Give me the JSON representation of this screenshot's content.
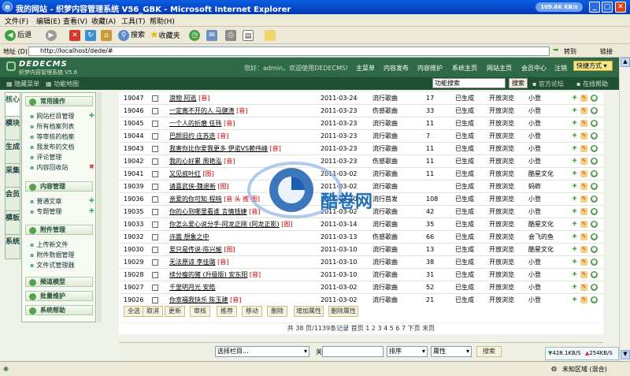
{
  "window": {
    "title": "我的网站 - 织梦内容管理系统 V56_GBK - Microsoft Internet Explorer",
    "speed": "109.6K KB/s"
  },
  "menubar": [
    "文件(F)",
    "编辑(E)",
    "查看(V)",
    "收藏(A)",
    "工具(T)",
    "帮助(H)"
  ],
  "toolbar": {
    "back": "后退",
    "search": "搜索",
    "favorites": "收藏夹"
  },
  "address": {
    "label": "地址 (D)",
    "url": "http://localhost/dede/#",
    "go": "转到",
    "links": "链接"
  },
  "header": {
    "logo": "DEDECMS",
    "logo_sub": "织梦内容管理系统",
    "version": "V5.6",
    "welcome": "您好：admin，欢迎使用DEDECMS!",
    "nav": [
      "主菜单",
      "内容发布",
      "内容维护",
      "系统主页",
      "网站主页",
      "会员中心",
      "注销"
    ],
    "quick": "快捷方式"
  },
  "subbar": {
    "hide_menu": "隐藏菜单",
    "func_map": "功能地图",
    "search_placeholder": "功能搜索",
    "search_btn": "搜索",
    "forum": "官方论坛",
    "help": "在线帮助"
  },
  "left_tabs": [
    "核心",
    "模块",
    "生成",
    "采集",
    "会员",
    "模板",
    "系统"
  ],
  "left_menu": {
    "sec1": "常用操作",
    "sec1_items": [
      "网站栏目管理",
      "所有档案列表",
      "等审核的档案",
      "我发布的文档",
      "评论管理",
      "内容回收站"
    ],
    "sec2": "内容管理",
    "sec2_items": [
      "普通文章",
      "专题管理"
    ],
    "sec3": "附件管理",
    "sec3_items": [
      "上传新文件",
      "附件数据管理",
      "文件式管理器"
    ],
    "sec4": "频道模型",
    "sec5": "批量维护",
    "sec6": "系统帮助"
  },
  "rows": [
    {
      "id": "19047",
      "title": "浪物 阿逃",
      "tag": "[音]",
      "date": "2011-03-24",
      "cat": "流行歌曲",
      "clicks": "17",
      "status": "已生成",
      "view": "开放浏览",
      "author": "小登"
    },
    {
      "id": "19046",
      "title": "一定离不开的人 马健涛",
      "tag": "[音]",
      "date": "2011-03-23",
      "cat": "伤感歌曲",
      "clicks": "33",
      "status": "已生成",
      "view": "开放浏览",
      "author": "小登"
    },
    {
      "id": "19045",
      "title": "一个人的折磨 任玮",
      "tag": "[音]",
      "date": "2011-03-23",
      "cat": "流行歌曲",
      "clicks": "11",
      "status": "已生成",
      "view": "开放浏览",
      "author": "小登"
    },
    {
      "id": "19044",
      "title": "巴颜旧约 庄苏迭",
      "tag": "[音]",
      "date": "2011-03-23",
      "cat": "流行歌曲",
      "clicks": "7",
      "status": "已生成",
      "view": "开放浏览",
      "author": "小登"
    },
    {
      "id": "19043",
      "title": "我害你比你爱我更多 伊诺VS赖伟峰",
      "tag": "[音]",
      "date": "2011-03-23",
      "cat": "流行歌曲",
      "clicks": "11",
      "status": "已生成",
      "view": "开放浏览",
      "author": "小登"
    },
    {
      "id": "19042",
      "title": "我的心好累 周艳泓",
      "tag": "[音]",
      "date": "2011-03-23",
      "cat": "伤感歌曲",
      "clicks": "11",
      "status": "已生成",
      "view": "开放浏览",
      "author": "小登"
    },
    {
      "id": "19041",
      "title": "又见叔叶红",
      "tag": "[图]",
      "date": "2011-03-02",
      "cat": "流行歌曲",
      "clicks": "11",
      "status": "已生成",
      "view": "开放浏览",
      "author": "酷星文化"
    },
    {
      "id": "19039",
      "title": "请喜武侠-魏退新",
      "tag": "[图]",
      "date": "2011-03-02",
      "cat": "流行歌曲",
      "clicks": "",
      "status": "已生成",
      "view": "开放浏览",
      "author": "蚂蚱"
    },
    {
      "id": "19036",
      "title": "亲爱的你可知 程响",
      "tag": "[音 头 推 图]",
      "date": "2011-03-10",
      "cat": "流行首发",
      "clicks": "108",
      "status": "已生成",
      "view": "开放浏览",
      "author": "小登"
    },
    {
      "id": "19035",
      "title": "你的心到哪里看谁 言情钱婕",
      "tag": "[音]",
      "date": "2011-03-02",
      "cat": "流行歌曲",
      "clicks": "42",
      "status": "已生成",
      "view": "开放浏览",
      "author": "小登"
    },
    {
      "id": "19033",
      "title": "你怎么爱心说分手-阿龙正刚 (阿龙正影)",
      "tag": "[图]",
      "date": "2011-03-14",
      "cat": "流行歌曲",
      "clicks": "35",
      "status": "已生成",
      "view": "开放浏览",
      "author": "酷星文化"
    },
    {
      "id": "19032",
      "title": "许嵩 想象之中",
      "tag": "",
      "date": "2011-03-13",
      "cat": "伤感歌曲",
      "clicks": "66",
      "status": "已生成",
      "view": "开放浏览",
      "author": "会飞的鱼"
    },
    {
      "id": "19030",
      "title": "爱只是传说-陈兴瑜",
      "tag": "[图]",
      "date": "2011-03-10",
      "cat": "流行歌曲",
      "clicks": "13",
      "status": "已生成",
      "view": "开放浏览",
      "author": "酷星文化"
    },
    {
      "id": "19029",
      "title": "无法原谅 李佳璐",
      "tag": "[音]",
      "date": "2011-03-10",
      "cat": "流行歌曲",
      "clicks": "38",
      "status": "已生成",
      "view": "开放浏览",
      "author": "小登"
    },
    {
      "id": "19028",
      "title": "续分瘦的猪 (升级版) 安东阳",
      "tag": "[音]",
      "date": "2011-03-10",
      "cat": "流行歌曲",
      "clicks": "31",
      "status": "已生成",
      "view": "开放浏览",
      "author": "小登"
    },
    {
      "id": "19027",
      "title": "千里明月光 安皓",
      "tag": "",
      "date": "2011-03-02",
      "cat": "流行歌曲",
      "clicks": "52",
      "status": "已生成",
      "view": "开放浏览",
      "author": "小登"
    },
    {
      "id": "19026",
      "title": "你幸福我快乐 陈玉建",
      "tag": "[音]",
      "date": "2011-03-02",
      "cat": "流行歌曲",
      "clicks": "21",
      "status": "已生成",
      "view": "开放浏览",
      "author": "小登"
    }
  ],
  "actions": [
    "全选",
    "取消",
    "更新",
    "审核",
    "推荐",
    "移动",
    "删除",
    "增加属性",
    "删除属性"
  ],
  "pager": "共 38 页/1139条记录 首页 1 2 3 4 5 6 7 下页 末页",
  "searchbar": {
    "category": "选择栏目...",
    "keyword_label": "关键字：",
    "sort": "排序",
    "attr": "属性",
    "btn": "搜索"
  },
  "status": {
    "zone": "未知区域 (混合)",
    "down": "428.1KB/S",
    "up": "254KB/S"
  },
  "watermark": "酷卷网"
}
